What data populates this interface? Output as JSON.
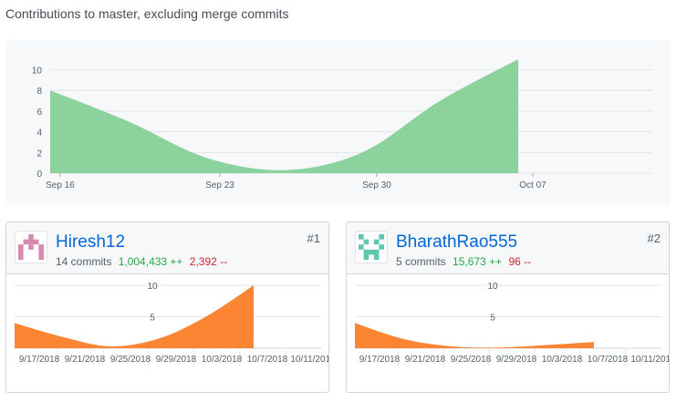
{
  "subtitle": "Contributions to master, excluding merge commits",
  "main_chart": {
    "y_ticks": [
      "0",
      "2",
      "4",
      "6",
      "8",
      "10"
    ],
    "x_ticks": [
      "Sep 16",
      "Sep 23",
      "Sep 30",
      "Oct 07"
    ],
    "fill_color": "#8cd29c"
  },
  "contributors": [
    {
      "username": "Hiresh12",
      "commits": "14 commits",
      "additions": "1,004,433 ++",
      "deletions": "2,392 --",
      "rank": "#1",
      "avatar_color": "#d889b2"
    },
    {
      "username": "BharathRao555",
      "commits": "5 commits",
      "additions": "15,673 ++",
      "deletions": "96 --",
      "rank": "#2",
      "avatar_color": "#5fc6b0"
    }
  ],
  "card_chart": {
    "y_ticks": [
      "5",
      "10"
    ],
    "x_ticks": [
      "9/17/2018",
      "9/21/2018",
      "9/25/2018",
      "9/29/2018",
      "10/3/2018",
      "10/7/2018",
      "10/11/2018"
    ],
    "fill_color": "#fb8532"
  },
  "chart_data": [
    {
      "type": "area",
      "title": "",
      "xlabel": "",
      "ylabel": "",
      "x": [
        "Sep 16",
        "Sep 19",
        "Sep 23",
        "Sep 26",
        "Sep 30",
        "Oct 03",
        "Oct 05"
      ],
      "y": [
        8,
        5,
        1.5,
        0.3,
        2,
        7,
        11
      ],
      "ylim": [
        0,
        11
      ],
      "grid": true
    },
    {
      "type": "area",
      "title": "Hiresh12",
      "x": [
        "9/17/2018",
        "9/21/2018",
        "9/25/2018",
        "9/29/2018",
        "10/3/2018",
        "10/7/2018"
      ],
      "y": [
        4,
        1.8,
        0.3,
        1.5,
        5,
        10
      ],
      "ylim": [
        0,
        10
      ],
      "grid": true
    },
    {
      "type": "area",
      "title": "BharathRao555",
      "x": [
        "9/17/2018",
        "9/21/2018",
        "9/25/2018",
        "9/29/2018",
        "10/3/2018",
        "10/7/2018"
      ],
      "y": [
        4,
        1.5,
        0.3,
        0.1,
        0.5,
        1
      ],
      "ylim": [
        0,
        10
      ],
      "grid": true
    }
  ]
}
